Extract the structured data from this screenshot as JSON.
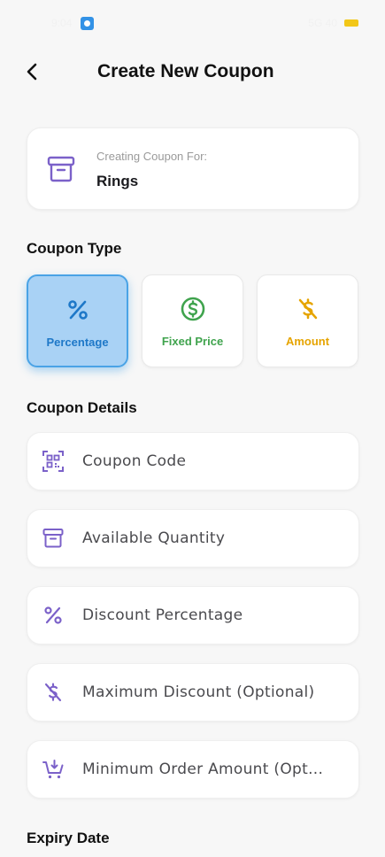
{
  "status_bar": {
    "time": "9:04",
    "right_text": "5G 40"
  },
  "header": {
    "title": "Create New Coupon"
  },
  "product": {
    "label": "Creating Coupon For:",
    "value": "Rings",
    "icon": "archive-box-icon"
  },
  "coupon_type": {
    "title": "Coupon Type",
    "options": [
      {
        "label": "Percentage",
        "icon": "percent-icon",
        "color": "#1e78c8",
        "selected": true
      },
      {
        "label": "Fixed Price",
        "icon": "dollar-circle-icon",
        "color": "#3fa34d",
        "selected": false
      },
      {
        "label": "Amount",
        "icon": "dollar-slash-icon",
        "color": "#e6a400",
        "selected": false
      }
    ]
  },
  "coupon_details": {
    "title": "Coupon Details",
    "fields": [
      {
        "placeholder": "Coupon Code",
        "icon": "qr-code-icon"
      },
      {
        "placeholder": "Available Quantity",
        "icon": "archive-box-icon"
      },
      {
        "placeholder": "Discount Percentage",
        "icon": "percent-icon"
      },
      {
        "placeholder": "Maximum Discount (Optional)",
        "icon": "dollar-slash-icon"
      },
      {
        "placeholder": "Minimum Order Amount (Opt...",
        "icon": "cart-add-icon"
      }
    ]
  },
  "expiry": {
    "title": "Expiry Date"
  },
  "colors": {
    "accent_purple": "#7b61c9",
    "selected_bg": "#a9d2f5",
    "selected_border": "#4aa3e6"
  }
}
